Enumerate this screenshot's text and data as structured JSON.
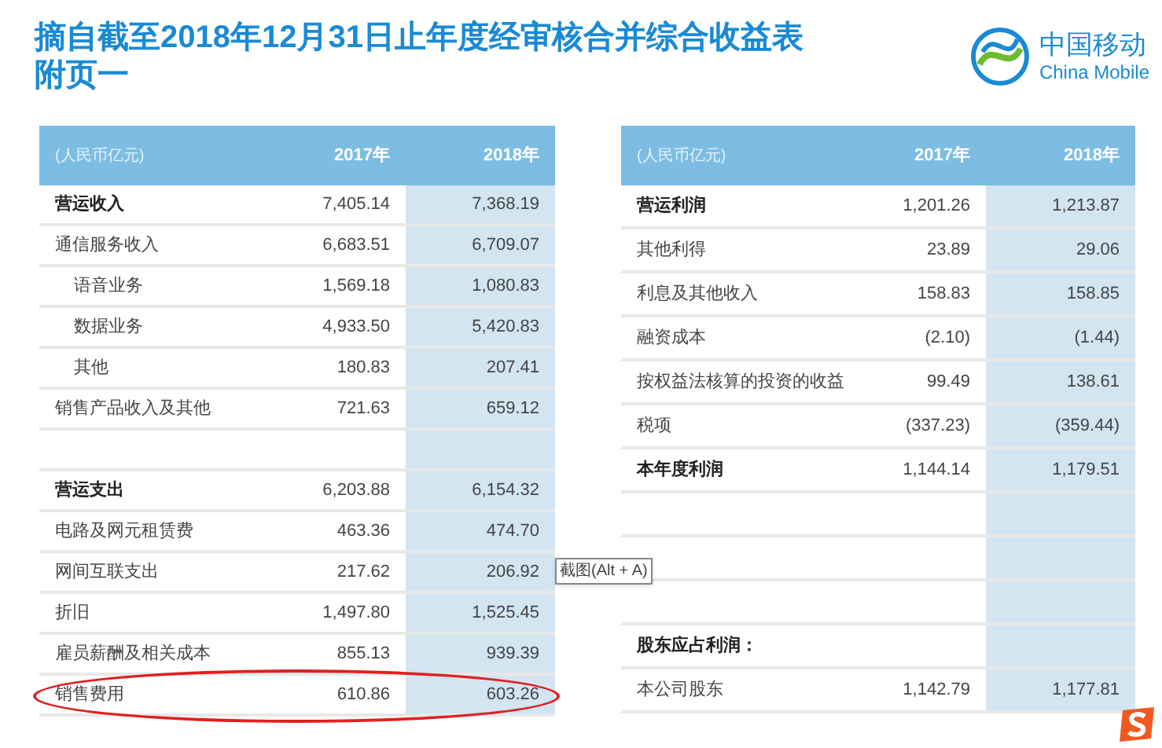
{
  "title_lines": [
    "摘自截至2018年12月31日止年度经审核合并综合收益表",
    "附页一"
  ],
  "logo": {
    "name": "中国移动",
    "name_en": "China Mobile"
  },
  "tables": [
    {
      "columns": [
        "(人民币亿元)",
        "2017年",
        "2018年"
      ],
      "rows": [
        {
          "kind": "heading",
          "label": "营运收入",
          "v2017": "7,405.14",
          "v2018": "7,368.19"
        },
        {
          "kind": "item",
          "label": "通信服务收入",
          "v2017": "6,683.51",
          "v2018": "6,709.07"
        },
        {
          "kind": "subitem",
          "label": "语音业务",
          "v2017": "1,569.18",
          "v2018": "1,080.83"
        },
        {
          "kind": "subitem",
          "label": "数据业务",
          "v2017": "4,933.50",
          "v2018": "5,420.83"
        },
        {
          "kind": "subitem",
          "label": "其他",
          "v2017": "180.83",
          "v2018": "207.41"
        },
        {
          "kind": "item",
          "label": "销售产品收入及其他",
          "v2017": "721.63",
          "v2018": "659.12"
        },
        {
          "kind": "blank"
        },
        {
          "kind": "heading",
          "label": "营运支出",
          "v2017": "6,203.88",
          "v2018": "6,154.32"
        },
        {
          "kind": "item",
          "label": "电路及网元租赁费",
          "v2017": "463.36",
          "v2018": "474.70"
        },
        {
          "kind": "item",
          "label": "网间互联支出",
          "v2017": "217.62",
          "v2018": "206.92"
        },
        {
          "kind": "item",
          "label": "折旧",
          "v2017": "1,497.80",
          "v2018": "1,525.45"
        },
        {
          "kind": "item",
          "label": "雇员薪酬及相关成本",
          "v2017": "855.13",
          "v2018": "939.39"
        },
        {
          "kind": "item",
          "label": "销售费用",
          "v2017": "610.86",
          "v2018": "603.26",
          "circled": true
        }
      ]
    },
    {
      "columns": [
        "(人民币亿元)",
        "2017年",
        "2018年"
      ],
      "rows": [
        {
          "kind": "heading",
          "label": "营运利润",
          "v2017": "1,201.26",
          "v2018": "1,213.87"
        },
        {
          "kind": "item",
          "label": "其他利得",
          "v2017": "23.89",
          "v2018": "29.06"
        },
        {
          "kind": "item",
          "label": "利息及其他收入",
          "v2017": "158.83",
          "v2018": "158.85"
        },
        {
          "kind": "item",
          "label": "融资成本",
          "v2017": "(2.10)",
          "v2018": "(1.44)"
        },
        {
          "kind": "item",
          "label": "按权益法核算的投资的收益",
          "v2017": "99.49",
          "v2018": "138.61"
        },
        {
          "kind": "item",
          "label": "税项",
          "v2017": "(337.23)",
          "v2018": "(359.44)"
        },
        {
          "kind": "heading",
          "label": "本年度利润",
          "v2017": "1,144.14",
          "v2018": "1,179.51"
        },
        {
          "kind": "blank"
        },
        {
          "kind": "blank"
        },
        {
          "kind": "blank"
        },
        {
          "kind": "heading",
          "label": "股东应占利润："
        },
        {
          "kind": "item",
          "label": "本公司股东",
          "v2017": "1,142.79",
          "v2018": "1,177.81"
        }
      ]
    }
  ],
  "tooltip": "截图(Alt + A)"
}
